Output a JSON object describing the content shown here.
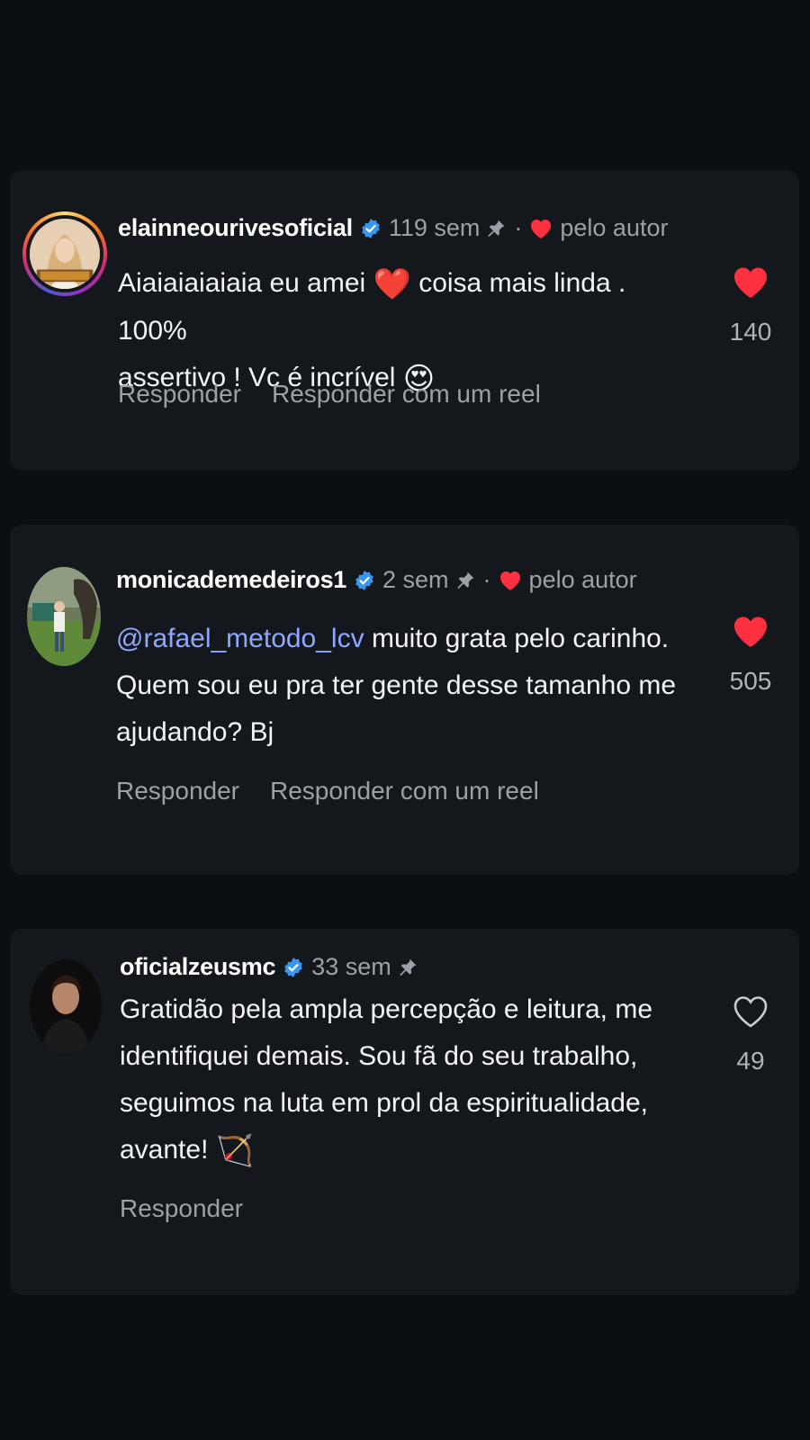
{
  "colors": {
    "background": "#0b0f13",
    "card": "#14181d",
    "verified_blue": "#3797f0",
    "heart_red": "#ff3040",
    "muted_text": "#9aa1a8",
    "mention": "#8fa8ff"
  },
  "comments": [
    {
      "username": "elainneourivesoficial",
      "verified": true,
      "time": "119 sem",
      "pinned": true,
      "separator": "·",
      "liked_by_author_label": "pelo autor",
      "text_lines": [
        "Aiaiaiaiaiaia eu amei",
        "coisa mais linda . 100%",
        "assertivo ! Vc é incrível"
      ],
      "emoji_1": "❤️",
      "emoji_2": "😍",
      "actions": [
        "Responder",
        "Responder com um reel"
      ],
      "liked": true,
      "like_count": "140",
      "avatar_icon": "profile-photo-woman-logo"
    },
    {
      "username": "monicademedeiros1",
      "verified": true,
      "time": "2 sem",
      "pinned": true,
      "separator": "·",
      "liked_by_author_label": "pelo autor",
      "mention": "@rafael_metodo_lcv",
      "text_after_mention": "muito grata pelo carinho.",
      "text_line_2": "Quem sou eu pra ter gente desse tamanho me",
      "text_line_3": "ajudando? Bj",
      "actions": [
        "Responder",
        "Responder com um reel"
      ],
      "liked": true,
      "like_count": "505",
      "avatar_icon": "profile-photo-outdoor"
    },
    {
      "username": "oficialzeusmc",
      "verified": true,
      "time": "33 sem",
      "pinned": true,
      "text_lines": [
        "Gratidão pela ampla percepção e leitura, me",
        "identifiquei demais. Sou fã do seu trabalho,",
        "seguimos na luta em prol da espiritualidade,",
        "avante!"
      ],
      "emoji": "🏹",
      "actions": [
        "Responder"
      ],
      "liked": false,
      "like_count": "49",
      "avatar_icon": "profile-photo-man"
    }
  ]
}
